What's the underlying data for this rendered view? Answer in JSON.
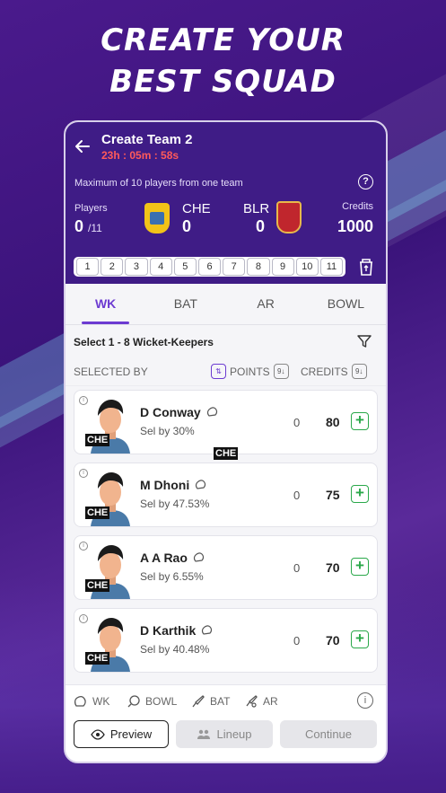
{
  "headline": {
    "line1": "CREATE YOUR",
    "line2": "BEST SQUAD"
  },
  "header": {
    "title": "Create Team 2",
    "timer": "23h : 05m : 58s"
  },
  "rules": {
    "max_note": "Maximum of 10 players from one team"
  },
  "summary": {
    "players_label": "Players",
    "players_count": "0",
    "players_total": "/11",
    "team1_name": "CHE",
    "team1_score": "0",
    "team2_name": "BLR",
    "team2_score": "0",
    "credits_label": "Credits",
    "credits_value": "1000"
  },
  "slots": [
    "1",
    "2",
    "3",
    "4",
    "5",
    "6",
    "7",
    "8",
    "9",
    "10",
    "11"
  ],
  "tabs": [
    "WK",
    "BAT",
    "AR",
    "BOWL"
  ],
  "section": {
    "label": "Select 1 - 8 Wicket-Keepers"
  },
  "sort": {
    "selected_by": "SELECTED BY",
    "points": "POINTS",
    "credits": "CREDITS"
  },
  "players": [
    {
      "name": "D Conway",
      "sel": "Sel by 30%",
      "team": "CHE",
      "points": "0",
      "credits": "80"
    },
    {
      "name": "M Dhoni",
      "sel": "Sel by 47.53%",
      "team": "CHE",
      "points": "0",
      "credits": "75"
    },
    {
      "name": "A A Rao",
      "sel": "Sel by 6.55%",
      "team": "CHE",
      "points": "0",
      "credits": "70"
    },
    {
      "name": "D Karthik",
      "sel": "Sel by 40.48%",
      "team": "CHE",
      "points": "0",
      "credits": "70"
    }
  ],
  "floating_tag": "CHE",
  "legend": {
    "wk": "WK",
    "bowl": "BOWL",
    "bat": "BAT",
    "ar": "AR"
  },
  "footer": {
    "preview": "Preview",
    "lineup": "Lineup",
    "continue": "Continue"
  },
  "colors": {
    "primary": "#3f1c86",
    "accent": "#6c3bd1",
    "timer": "#ff5a5a",
    "add": "#2aa84a"
  }
}
